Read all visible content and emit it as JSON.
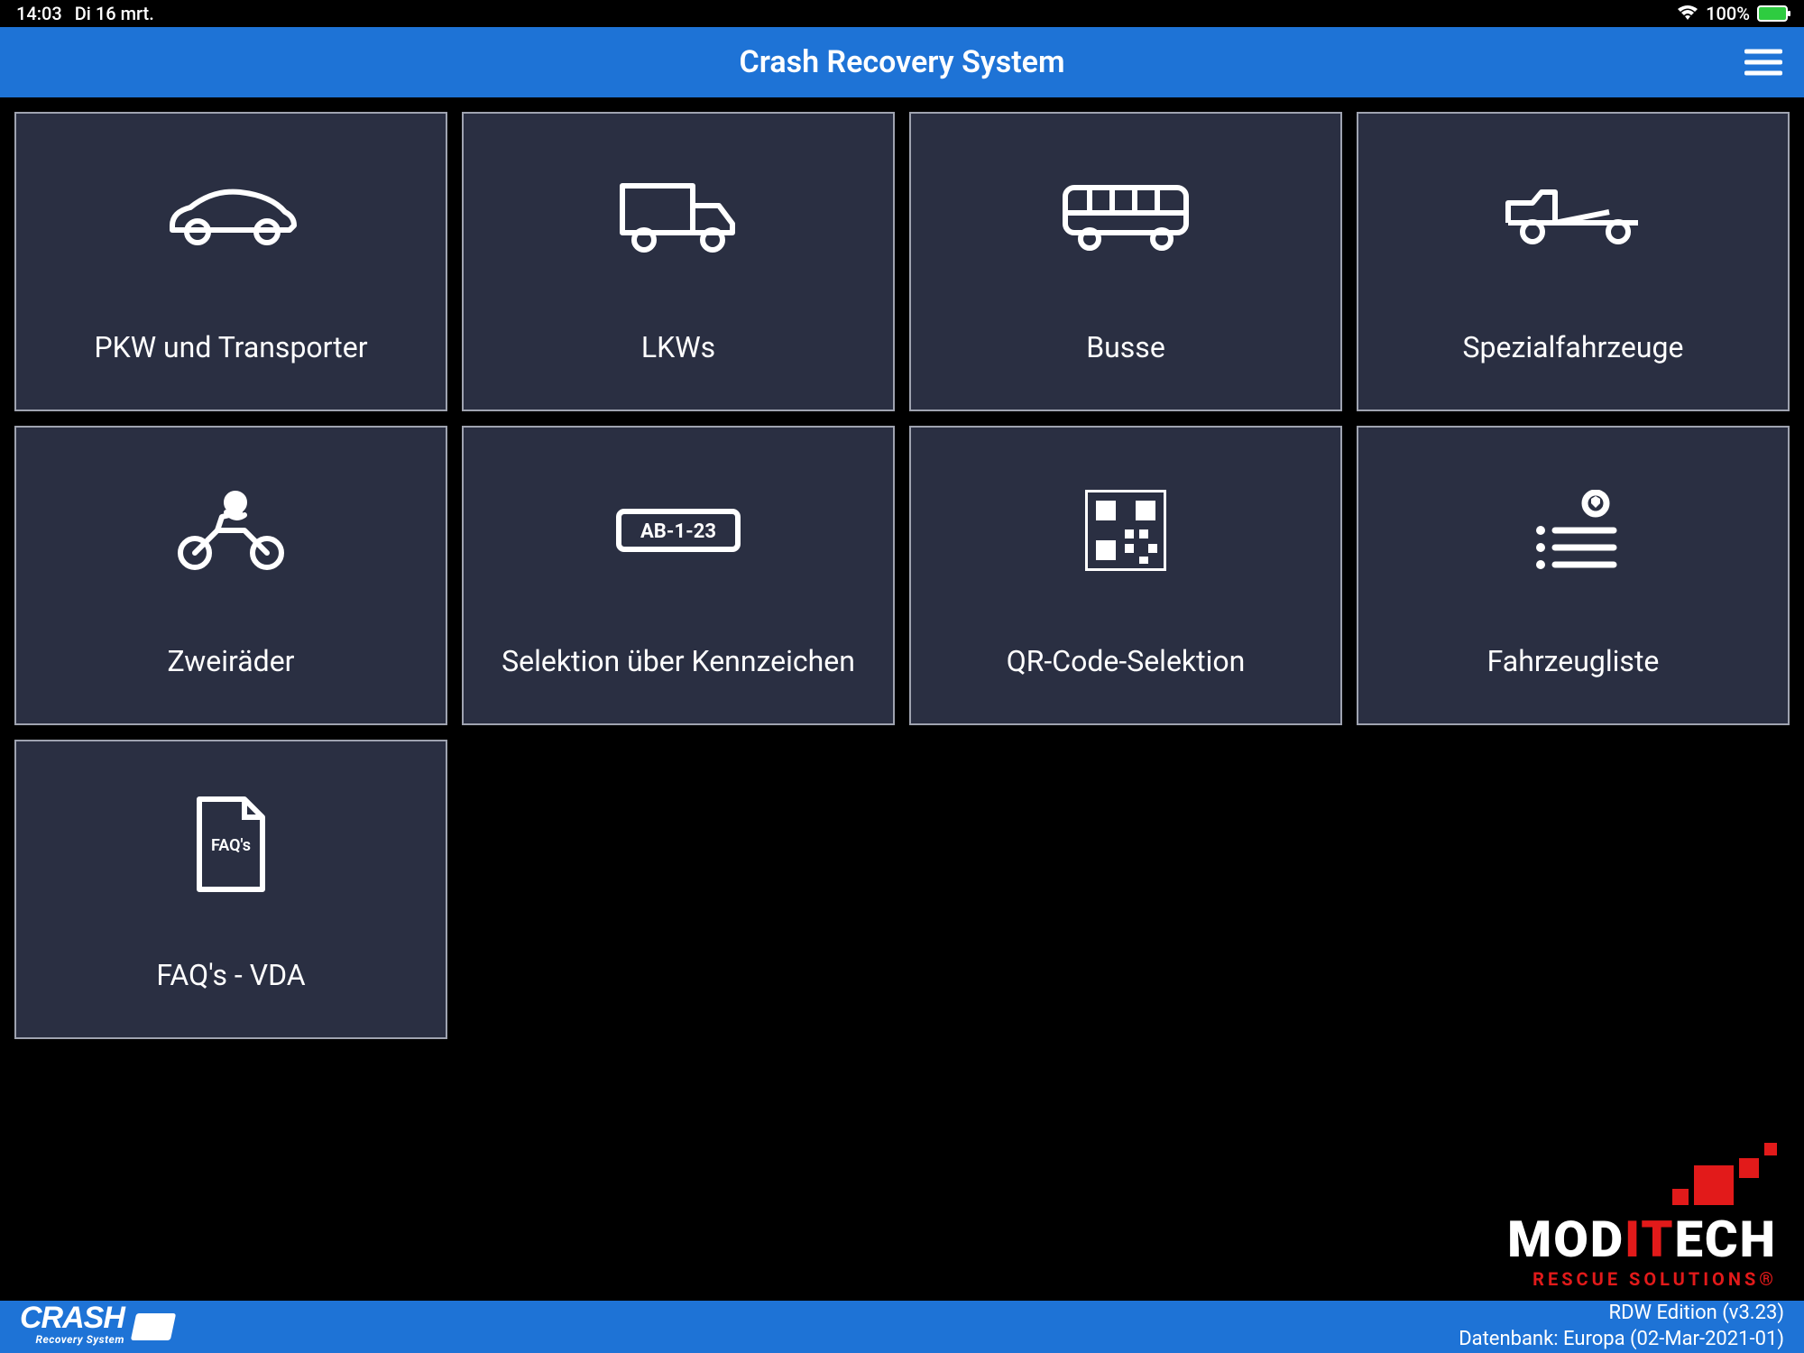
{
  "status": {
    "time": "14:03",
    "date": "Di 16 mrt.",
    "battery": "100%"
  },
  "header": {
    "title": "Crash Recovery System"
  },
  "tiles": [
    {
      "icon": "car-icon",
      "label": "PKW und Transporter"
    },
    {
      "icon": "truck-icon",
      "label": "LKWs"
    },
    {
      "icon": "bus-icon",
      "label": "Busse"
    },
    {
      "icon": "special-vehicle-icon",
      "label": "Spezialfahrzeuge"
    },
    {
      "icon": "motorcycle-icon",
      "label": "Zweiräder"
    },
    {
      "icon": "license-plate-icon",
      "label": "Selektion über Kennzeichen",
      "plate": "AB-1-23"
    },
    {
      "icon": "qr-code-icon",
      "label": "QR-Code-Selektion"
    },
    {
      "icon": "vehicle-list-icon",
      "label": "Fahrzeugliste"
    },
    {
      "icon": "faq-document-icon",
      "label": "FAQ's - VDA",
      "doc_text": "FAQ's"
    }
  ],
  "brand": {
    "name_part1": "MOD",
    "name_part2": "IT",
    "name_part3": "ECH",
    "tagline": "RESCUE SOLUTIONS®"
  },
  "footer": {
    "logo_main": "CRASH",
    "logo_sub": "Recovery System",
    "edition": "RDW Edition (v3.23)",
    "database": "Datenbank: Europa (02-Mar-2021-01)"
  }
}
